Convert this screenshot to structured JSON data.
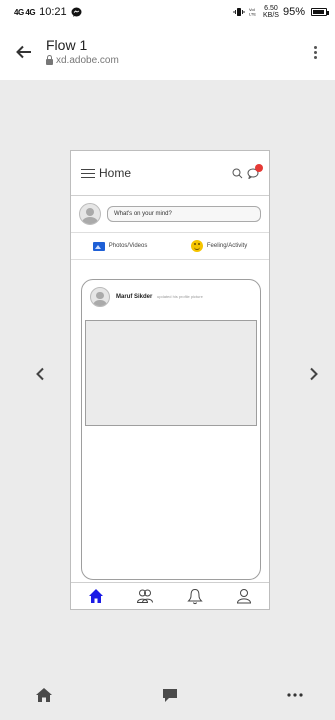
{
  "status_bar": {
    "signal_text": "4G 4G",
    "time": "10:21",
    "speed_value": "6.50",
    "speed_unit": "KB/S",
    "battery": "95%"
  },
  "browser_header": {
    "title": "Flow 1",
    "url": "xd.adobe.com"
  },
  "prototype": {
    "header": {
      "title": "Home"
    },
    "composer": {
      "placeholder": "What's on your mind?"
    },
    "actions": [
      {
        "label": "Photos/Videos",
        "icon": "photo-icon"
      },
      {
        "label": "Feeling/Activity",
        "icon": "smile-icon"
      }
    ],
    "post": {
      "author": "Maruf Sikder",
      "meta": "updated his profile picture"
    },
    "tabs": [
      {
        "name": "home",
        "icon": "home-icon",
        "active": true
      },
      {
        "name": "friends",
        "icon": "friends-icon",
        "active": false
      },
      {
        "name": "notifications",
        "icon": "bell-icon",
        "active": false
      },
      {
        "name": "profile",
        "icon": "profile-icon",
        "active": false
      }
    ],
    "accent_color": "#1a1ae6",
    "badge_color": "#e53935"
  },
  "navigation": {
    "prev": "‹",
    "next": "›"
  }
}
